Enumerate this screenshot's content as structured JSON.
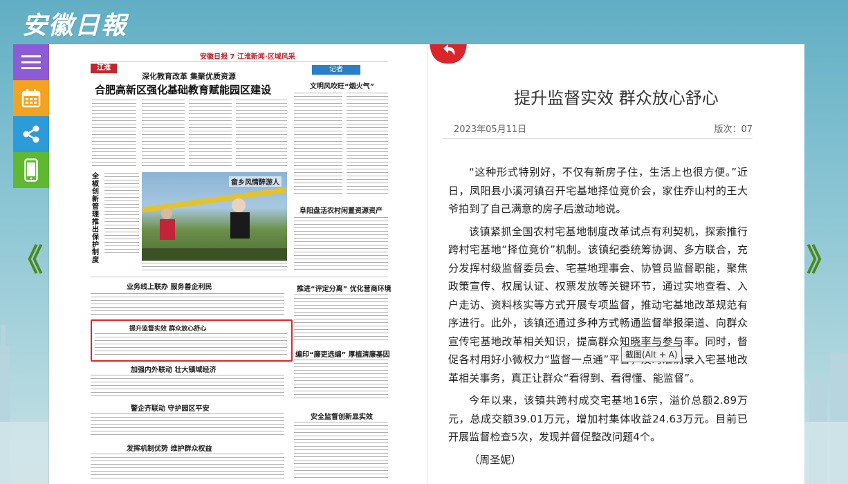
{
  "site": {
    "logo_text": "安徽日報"
  },
  "toolbar": {
    "items": [
      {
        "icon": "menu-icon",
        "color": "#8e5bd6"
      },
      {
        "icon": "calendar-icon",
        "color": "#f4a321"
      },
      {
        "icon": "share-icon",
        "color": "#2d9bd8"
      },
      {
        "icon": "mobile-icon",
        "color": "#5fb830"
      }
    ]
  },
  "nav": {
    "prev": "《",
    "next": "》"
  },
  "newspaper": {
    "header": "安徽日报  7  江淮新闻·区域风采",
    "column_tag": "江淮",
    "kicker": "深化教育改革 集聚优质资源",
    "main_headline": "合肥高新区强化基础教育赋能园区建设",
    "side_tag": "记者",
    "side_headline": "文明风吹旺“烟火气”",
    "vertical_headline": "全椒创新管理推出保护制度",
    "photo_caption": "畲乡风情醉游人",
    "story_fuyang": "阜阳盘活农村闲置资源资产",
    "story_service": "业务线上联办 服务善企利民",
    "story_pingding": "推进“评定分离” 优化营商环境",
    "story_highlight": "提升监督实效 群众放心舒心",
    "story_lianzheng": "编印“廉吏选编” 厚植清廉基因",
    "story_linkage": "加强内外联动 壮大镇域经济",
    "story_police": "警企齐联动 守护园区平安",
    "story_supervise": "安全监督创新显实效",
    "story_rights": "发挥机制优势 维护群众权益"
  },
  "article": {
    "title": "提升监督实效 群众放心舒心",
    "date": "2023年05月11日",
    "edition": "版次：07",
    "paragraphs": [
      "“这种形式特别好，不仅有新房子住，生活上也很方便。”近日，凤阳县小溪河镇召开宅基地择位竞价会，家住乔山村的王大爷拍到了自己满意的房子后激动地说。",
      "该镇紧抓全国农村宅基地制度改革试点有利契机，探索推行跨村宅基地“择位竞价”机制。该镇纪委统筹协调、多方联合，充分发挥村级监督委员会、宅基地理事会、协管员监督职能，聚焦政策宣传、权属认证、权票发放等关键环节，通过实地查看、入户走访、资料核实等方式开展专项监督，推动宅基地改革规范有序进行。此外，该镇还通过多种方式畅通监督举报渠道、向群众宣传宅基地改革相关知识，提高群众知晓率与参与率。同时，督促各村用好小微权力“监督一点通”平台，及时准确录入宅基地改革相关事务，真正让群众“看得到、看得懂、能监督”。",
      "今年以来，该镇共跨村成交宅基地16宗，溢价总额2.89万元，总成交额39.01万元，增加村集体收益24.63万元。目前已开展监督检查5次，发现并督促整改问题4个。",
      "（周圣妮）"
    ]
  },
  "tooltip": {
    "text": "截图(Alt + A)"
  },
  "colors": {
    "accent_red": "#d9252b",
    "nav_green": "#4a8a1c"
  }
}
